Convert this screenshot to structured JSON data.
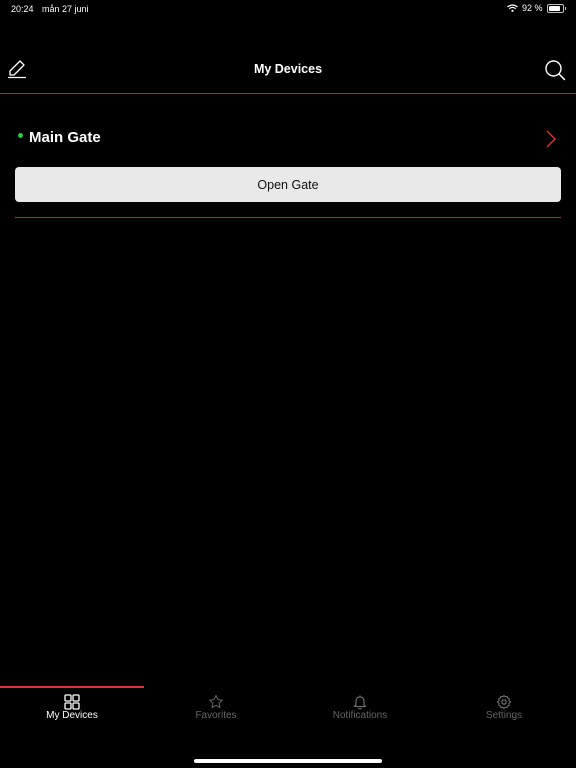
{
  "status_bar": {
    "time": "20:24",
    "date": "mån 27 juni",
    "battery_percent": "92 %",
    "battery_level": 0.92
  },
  "nav": {
    "title": "My Devices",
    "edit_icon": "pencil-icon",
    "search_icon": "search-icon"
  },
  "device": {
    "name": "Main Gate",
    "status": "online",
    "status_color": "#2ecc40",
    "action_label": "Open Gate"
  },
  "colors": {
    "accent": "#d83838",
    "divider": "#b22a2a",
    "background": "#000000",
    "button_bg": "#e9e9e9"
  },
  "tabs": [
    {
      "label": "My Devices",
      "icon": "grid-icon",
      "active": true
    },
    {
      "label": "Favorites",
      "icon": "star-icon",
      "active": false
    },
    {
      "label": "Notifications",
      "icon": "bell-icon",
      "active": false
    },
    {
      "label": "Settings",
      "icon": "gear-icon",
      "active": false
    }
  ]
}
